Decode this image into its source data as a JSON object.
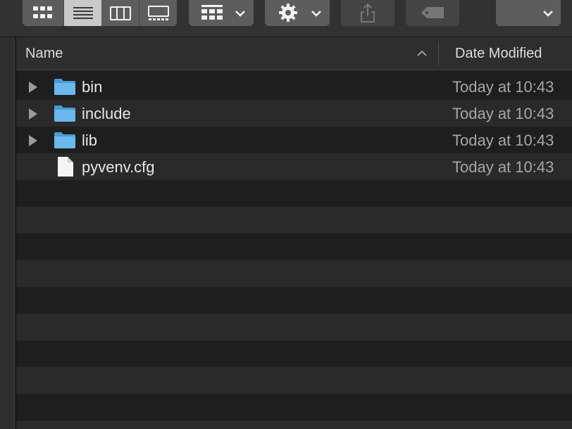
{
  "toolbar": {
    "view_buttons": [
      {
        "name": "icon-view",
        "selected": false
      },
      {
        "name": "list-view",
        "selected": true
      },
      {
        "name": "column-view",
        "selected": false
      },
      {
        "name": "gallery-view",
        "selected": false
      }
    ],
    "icons": {
      "group": "group-by-icon",
      "action": "gear-icon",
      "share": "share-icon",
      "tag": "tag-icon",
      "chevron": "chevron-down-icon"
    }
  },
  "list": {
    "columns": {
      "name": "Name",
      "date": "Date Modified"
    },
    "sort_indicator": "ascending",
    "rows": [
      {
        "name": "bin",
        "date": "Today at 10:43",
        "type": "folder"
      },
      {
        "name": "include",
        "date": "Today at 10:43",
        "type": "folder"
      },
      {
        "name": "lib",
        "date": "Today at 10:43",
        "type": "folder"
      },
      {
        "name": "pyvenv.cfg",
        "date": "Today at 10:43",
        "type": "file"
      }
    ]
  },
  "colors": {
    "folder": "#5aaee6",
    "row_alt": "#2a2a2a",
    "row_base": "#1e1e1e",
    "toolbar": "#323232"
  }
}
